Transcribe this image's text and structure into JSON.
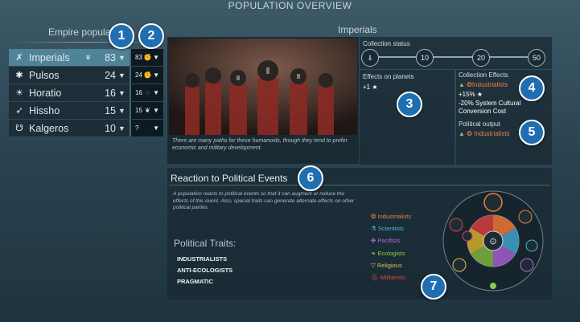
{
  "header": {
    "title": "POPULATION OVERVIEW"
  },
  "empire": {
    "heading": "Empire population",
    "rows": [
      {
        "name": "Imperials",
        "count": "83",
        "small": "83",
        "icon": "banner-icon",
        "selected": true
      },
      {
        "name": "Pulsos",
        "count": "24",
        "small": "24",
        "icon": "spark-icon",
        "selected": false
      },
      {
        "name": "Horatio",
        "count": "16",
        "small": "16",
        "icon": "insect-icon",
        "selected": false
      },
      {
        "name": "Hissho",
        "count": "15",
        "small": "15",
        "icon": "wing-icon",
        "selected": false
      },
      {
        "name": "Kalgeros",
        "count": "10",
        "small": "?",
        "icon": "claw-icon",
        "selected": false
      }
    ]
  },
  "badges": [
    "1",
    "2",
    "3",
    "4",
    "5",
    "6",
    "7"
  ],
  "detail": {
    "name": "Imperials",
    "caption": "There are many paths for these humanoids, though they tend to prefer economic and military development.",
    "collection_status": {
      "label": "Collection status",
      "thresholds": [
        "10",
        "20",
        "50"
      ]
    },
    "effects_on_planets": {
      "label": "Effects on planets",
      "value": "+1 ★"
    },
    "collection_effects": {
      "label": "Collection Effects",
      "faction": "Industrialists",
      "bonus": "+15% ★",
      "cost": "-20% System Cultural Conversion Cost"
    },
    "political_output": {
      "label": "Political output",
      "faction": "Industrialists"
    }
  },
  "reaction": {
    "title": "Reaction to Political Events",
    "description": "A population reacts to political events so that it can augment or reduce the effects of this event. Also, special traits can generate alternate effects on other political parties.",
    "traits_label": "Political Traits:",
    "traits": [
      "INDUSTRIALISTS",
      "ANTI-ECOLOGISTS",
      "PRAGMATIC"
    ],
    "legend": [
      {
        "name": "Industrialists",
        "color": "#ee7f3d",
        "icon": "gear-icon"
      },
      {
        "name": "Scientists",
        "color": "#4ab7e0",
        "icon": "flask-icon"
      },
      {
        "name": "Pacifists",
        "color": "#b06de0",
        "icon": "dove-icon"
      },
      {
        "name": "Ecologists",
        "color": "#8fc84a",
        "icon": "leaf-icon"
      },
      {
        "name": "Religious",
        "color": "#e2c24a",
        "icon": "triangle-icon"
      },
      {
        "name": "Militarists",
        "color": "#e04646",
        "icon": "helmet-icon"
      }
    ]
  }
}
